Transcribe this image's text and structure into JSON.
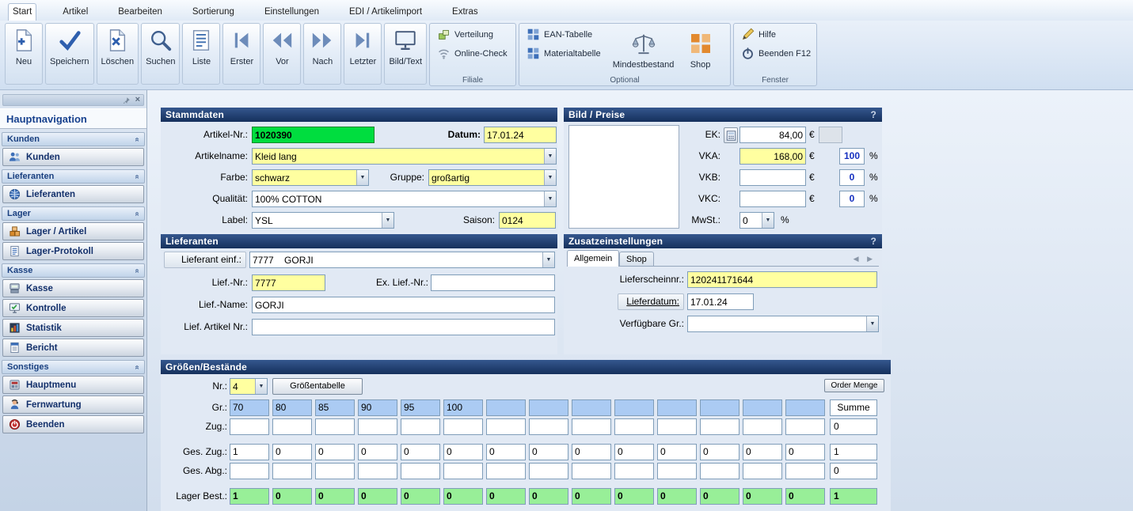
{
  "colors": {
    "accent_green": "#00dd3f",
    "highlight_yellow": "#ffffa0",
    "size_cell_blue": "#abcbf3",
    "stock_cell_green": "#98ef98",
    "header_navy": "#15305c"
  },
  "menubar": {
    "tabs": [
      {
        "label": "Start",
        "active": true
      },
      {
        "label": "Artikel"
      },
      {
        "label": "Bearbeiten"
      },
      {
        "label": "Sortierung"
      },
      {
        "label": "Einstellungen"
      },
      {
        "label": "EDI / Artikelimport"
      },
      {
        "label": "Extras"
      }
    ]
  },
  "ribbon": {
    "buttons": [
      {
        "label": "Neu",
        "icon": "document-plus"
      },
      {
        "label": "Speichern",
        "icon": "checkmark"
      },
      {
        "label": "Löschen",
        "icon": "document-x"
      },
      {
        "label": "Suchen",
        "icon": "magnifier"
      },
      {
        "label": "Liste",
        "icon": "list"
      },
      {
        "label": "Erster",
        "icon": "nav-first"
      },
      {
        "label": "Vor",
        "icon": "nav-previous"
      },
      {
        "label": "Nach",
        "icon": "nav-next"
      },
      {
        "label": "Letzter",
        "icon": "nav-last"
      },
      {
        "label": "Bild/Text",
        "icon": "monitor"
      }
    ],
    "filiale": {
      "label": "Filiale",
      "verteilung": "Verteilung",
      "online_check": "Online-Check"
    },
    "optional": {
      "label": "Optional",
      "ean": "EAN-Tabelle",
      "material": "Materialtabelle",
      "mindest": "Mindestbestand",
      "shop": "Shop"
    },
    "fenster": {
      "label": "Fenster",
      "hilfe": "Hilfe",
      "beenden": "Beenden F12"
    }
  },
  "sidebar": {
    "title": "Hauptnavigation",
    "sections": [
      {
        "header": "Kunden",
        "items": [
          {
            "label": "Kunden",
            "icon": "people"
          }
        ]
      },
      {
        "header": "Lieferanten",
        "items": [
          {
            "label": "Lieferanten",
            "icon": "globe"
          }
        ]
      },
      {
        "header": "Lager",
        "items": [
          {
            "label": "Lager / Artikel",
            "icon": "boxes"
          },
          {
            "label": "Lager-Protokoll",
            "icon": "protocol-list"
          }
        ]
      },
      {
        "header": "Kasse",
        "items": [
          {
            "label": "Kasse",
            "icon": "cash-register"
          },
          {
            "label": "Kontrolle",
            "icon": "monitor-check"
          },
          {
            "label": "Statistik",
            "icon": "bar-chart"
          },
          {
            "label": "Bericht",
            "icon": "report"
          }
        ]
      },
      {
        "header": "Sonstiges",
        "items": [
          {
            "label": "Hauptmenu",
            "icon": "main-menu"
          },
          {
            "label": "Fernwartung",
            "icon": "remote-support"
          },
          {
            "label": "Beenden",
            "icon": "power-red"
          }
        ]
      }
    ]
  },
  "stammdaten": {
    "title": "Stammdaten",
    "artikel_nr_label": "Artikel-Nr.:",
    "artikel_nr": "1020390",
    "datum_label": "Datum:",
    "datum": "17.01.24",
    "artikelname_label": "Artikelname:",
    "artikelname": "Kleid lang",
    "farbe_label": "Farbe:",
    "farbe": "schwarz",
    "gruppe_label": "Gruppe:",
    "gruppe": "großartig",
    "qualitaet_label": "Qualität:",
    "qualitaet": "100% COTTON",
    "label_label": "Label:",
    "label": "YSL",
    "saison_label": "Saison:",
    "saison": "0124"
  },
  "bild_preise": {
    "title": "Bild / Preise",
    "help": "?",
    "ek_label": "EK:",
    "ek": "84,00",
    "vka_label": "VKA:",
    "vka": "168,00",
    "vka_pct": "100",
    "vkb_label": "VKB:",
    "vkb": "",
    "vkb_pct": "0",
    "vkc_label": "VKC:",
    "vkc": "",
    "vkc_pct": "0",
    "mwst_label": "MwSt.:",
    "mwst": "0",
    "euro": "€",
    "pct": "%"
  },
  "lieferanten": {
    "title": "Lieferanten",
    "einf_label": "Lieferant einf.:",
    "einf": "7777    GORJI",
    "nr_label": "Lief.-Nr.:",
    "nr": "7777",
    "ex_label": "Ex. Lief.-Nr.:",
    "ex": "",
    "name_label": "Lief.-Name:",
    "name": "GORJI",
    "artnr_label": "Lief. Artikel Nr.:",
    "artnr": ""
  },
  "zusatz": {
    "title": "Zusatzeinstellungen",
    "help": "?",
    "tabs": [
      {
        "label": "Allgemein",
        "active": true
      },
      {
        "label": "Shop",
        "active": false
      }
    ],
    "lieferschein_label": "Lieferscheinnr.:",
    "lieferschein": "120241171644",
    "lieferdatum_label": "Lieferdatum:",
    "lieferdatum": "17.01.24",
    "verfuegbar_label": "Verfügbare Gr.:",
    "verfuegbar": ""
  },
  "groessen": {
    "title": "Größen/Bestände",
    "nr_label": "Nr.:",
    "nr": "4",
    "tabelle_button": "Größentabelle",
    "order_button": "Order Menge",
    "summe_header": "Summe",
    "rows": {
      "gr": {
        "label": "Gr.:",
        "cells": [
          "70",
          "80",
          "85",
          "90",
          "95",
          "100",
          "",
          "",
          "",
          "",
          "",
          "",
          "",
          ""
        ]
      },
      "zug": {
        "label": "Zug.:",
        "cells": [
          "",
          "",
          "",
          "",
          "",
          "",
          "",
          "",
          "",
          "",
          "",
          "",
          "",
          ""
        ],
        "summe": "0"
      },
      "ges_zug": {
        "label": "Ges. Zug.:",
        "cells": [
          "1",
          "0",
          "0",
          "0",
          "0",
          "0",
          "0",
          "0",
          "0",
          "0",
          "0",
          "0",
          "0",
          "0"
        ],
        "summe": "1"
      },
      "ges_abg": {
        "label": "Ges. Abg.:",
        "cells": [
          "",
          "",
          "",
          "",
          "",
          "",
          "",
          "",
          "",
          "",
          "",
          "",
          "",
          ""
        ],
        "summe": "0"
      },
      "lager_best": {
        "label": "Lager Best.:",
        "cells": [
          "1",
          "0",
          "0",
          "0",
          "0",
          "0",
          "0",
          "0",
          "0",
          "0",
          "0",
          "0",
          "0",
          "0"
        ],
        "summe": "1"
      }
    }
  }
}
